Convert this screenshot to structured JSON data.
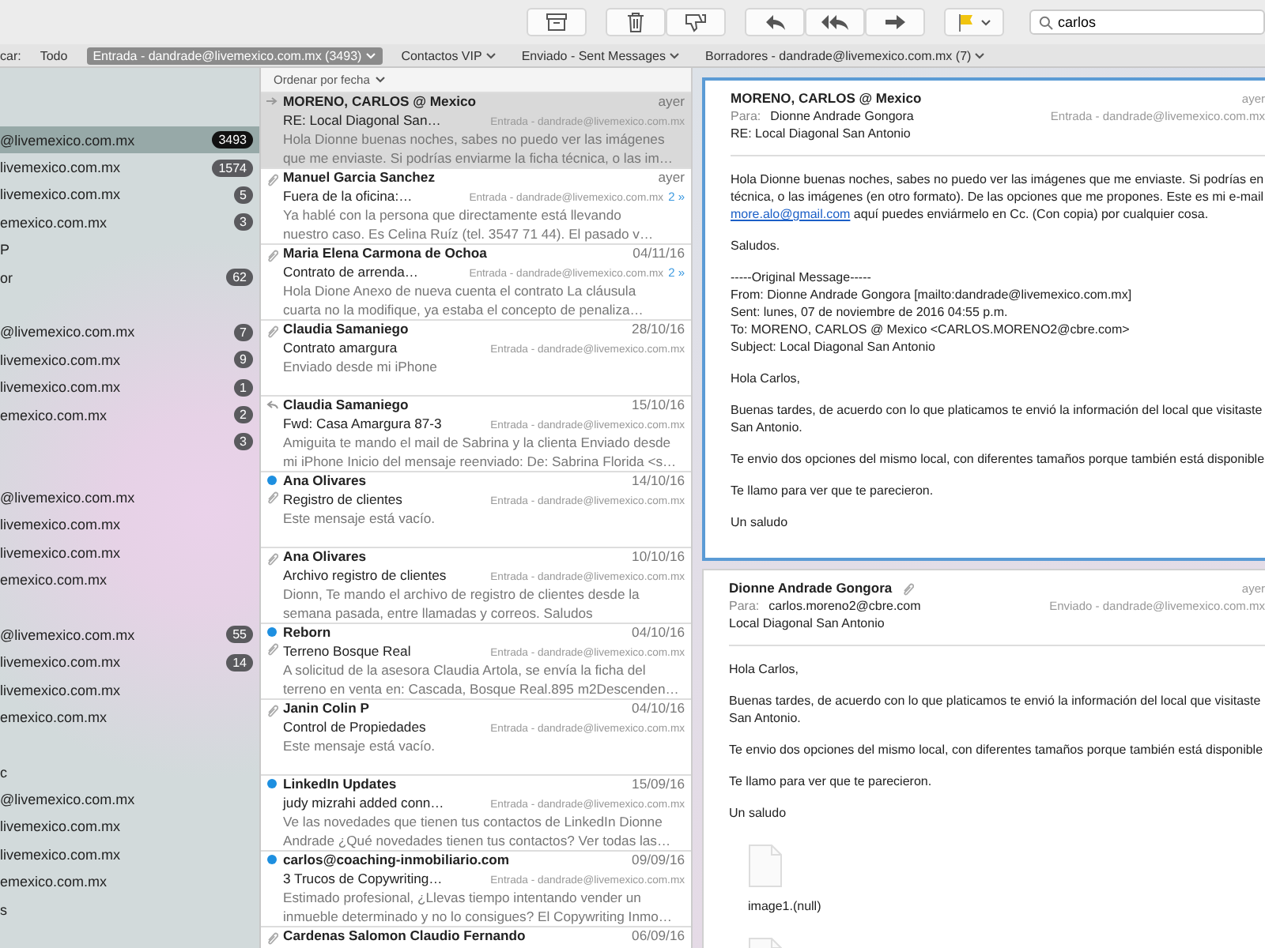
{
  "toolbar": {
    "buttons": [
      {
        "kind": "archive"
      },
      {
        "kind": "trash"
      },
      {
        "kind": "junk"
      },
      {
        "kind": "reply"
      },
      {
        "kind": "reply-all"
      },
      {
        "kind": "forward"
      },
      {
        "kind": "flag"
      }
    ],
    "search": {
      "value": "carlos"
    }
  },
  "scope_bar": {
    "label": "car:",
    "items": [
      {
        "label": "Todo",
        "selected": false
      },
      {
        "label": "Entrada - dandrade@livemexico.com.mx (3493)",
        "selected": true,
        "menu": true
      },
      {
        "label": "Contactos VIP",
        "selected": false,
        "menu": true
      },
      {
        "label": "Enviado - Sent Messages",
        "selected": false,
        "menu": true
      },
      {
        "label": "Borradores - dandrade@livemexico.com.mx (7)",
        "selected": false,
        "menu": true
      }
    ]
  },
  "sidebar": {
    "items": [
      {
        "kind": "row",
        "label": "@livemexico.com.mx",
        "count": "3493",
        "selected": true
      },
      {
        "kind": "row",
        "label": "livemexico.com.mx",
        "count": "1574",
        "selected": false
      },
      {
        "kind": "row",
        "label": "livemexico.com.mx",
        "count": "5",
        "selected": false
      },
      {
        "kind": "row",
        "label": "emexico.com.mx",
        "count": "3",
        "selected": false
      },
      {
        "kind": "row",
        "label": "P",
        "selected": false
      },
      {
        "kind": "row",
        "label": "or",
        "count": "62",
        "selected": false
      },
      {
        "kind": "gap"
      },
      {
        "kind": "row",
        "label": "@livemexico.com.mx",
        "count": "7",
        "selected": false
      },
      {
        "kind": "row",
        "label": "livemexico.com.mx",
        "count": "9",
        "selected": false
      },
      {
        "kind": "row",
        "label": "livemexico.com.mx",
        "count": "1",
        "selected": false
      },
      {
        "kind": "row",
        "label": "emexico.com.mx",
        "count": "2",
        "selected": false
      },
      {
        "kind": "row",
        "count": "3",
        "selected": false
      },
      {
        "kind": "gap"
      },
      {
        "kind": "row",
        "label": "@livemexico.com.mx",
        "selected": false
      },
      {
        "kind": "row",
        "label": "livemexico.com.mx",
        "selected": false
      },
      {
        "kind": "row",
        "label": "livemexico.com.mx",
        "selected": false
      },
      {
        "kind": "row",
        "label": "emexico.com.mx",
        "selected": false
      },
      {
        "kind": "gap"
      },
      {
        "kind": "row",
        "label": "@livemexico.com.mx",
        "count": "55",
        "selected": false
      },
      {
        "kind": "row",
        "label": "livemexico.com.mx",
        "count": "14",
        "selected": false
      },
      {
        "kind": "row",
        "label": "livemexico.com.mx",
        "selected": false
      },
      {
        "kind": "row",
        "label": "emexico.com.mx",
        "selected": false
      },
      {
        "kind": "gap"
      },
      {
        "kind": "row",
        "label": "c",
        "selected": false
      },
      {
        "kind": "row",
        "label": "@livemexico.com.mx",
        "selected": false
      },
      {
        "kind": "row",
        "label": "livemexico.com.mx",
        "selected": false
      },
      {
        "kind": "row",
        "label": "livemexico.com.mx",
        "selected": false
      },
      {
        "kind": "row",
        "label": "emexico.com.mx",
        "selected": false
      },
      {
        "kind": "row",
        "label": "s",
        "selected": false
      }
    ]
  },
  "message_list": {
    "sort": "Ordenar por fecha",
    "messages": [
      {
        "sender": "MORENO, CARLOS @ Mexico",
        "date": "ayer",
        "subject": "RE: Local Diagonal San…",
        "mailbox": "Entrada - dandrade@livemexico.com.mx",
        "preview_lines": [
          "Hola Dionne buenas noches, sabes no puedo ver las imágenes",
          "que me enviaste. Si podrías enviarme la ficha técnica, o las im…"
        ],
        "selected": true,
        "unread": false,
        "forwarded": true,
        "replied": false,
        "attachment": false
      },
      {
        "sender": "Manuel Garcia Sanchez",
        "date": "ayer",
        "subject": "Fuera de la oficina:…",
        "mailbox": "Entrada - dandrade@livemexico.com.mx",
        "thread": "2 »",
        "preview_lines": [
          "Ya hablé con la persona que directamente está llevando",
          "nuestro caso. Es Celina Ruíz (tel. 3547 71 44). El pasado v…"
        ],
        "selected": false,
        "unread": false,
        "attachment": true
      },
      {
        "sender": "Maria Elena Carmona de Ochoa",
        "date": "04/11/16",
        "subject": "Contrato de arrenda…",
        "mailbox": "Entrada - dandrade@livemexico.com.mx",
        "thread": "2 »",
        "preview_lines": [
          "Hola Dione Anexo de nueva cuenta el contrato La cláusula",
          "cuarta no la modifique, ya estaba el concepto de penaliza…"
        ],
        "selected": false,
        "unread": false,
        "attachment": true
      },
      {
        "sender": "Claudia Samaniego",
        "date": "28/10/16",
        "subject": "Contrato amargura",
        "mailbox": "Entrada - dandrade@livemexico.com.mx",
        "preview_lines": [
          "Enviado desde mi iPhone"
        ],
        "selected": false,
        "unread": false,
        "attachment": true
      },
      {
        "sender": "Claudia Samaniego",
        "date": "15/10/16",
        "subject": "Fwd: Casa Amargura 87-3",
        "mailbox": "Entrada - dandrade@livemexico.com.mx",
        "preview_lines": [
          "Amiguita te mando el mail de Sabrina y la clienta Enviado desde",
          "mi iPhone Inicio del mensaje reenviado: De: Sabrina Florida <s…"
        ],
        "selected": false,
        "unread": false,
        "forwarded": false,
        "replied": true,
        "attachment": false
      },
      {
        "sender": "Ana Olivares",
        "date": "14/10/16",
        "subject": "Registro de clientes",
        "mailbox": "Entrada - dandrade@livemexico.com.mx",
        "preview_lines": [
          "Este mensaje está vacío."
        ],
        "selected": false,
        "unread": true,
        "attachment": true
      },
      {
        "sender": "Ana Olivares",
        "date": "10/10/16",
        "subject": "Archivo registro de clientes",
        "mailbox": "Entrada - dandrade@livemexico.com.mx",
        "preview_lines": [
          "Dionn, Te mando el archivo de registro de clientes desde la",
          "semana pasada, entre llamadas y correos. Saludos"
        ],
        "selected": false,
        "unread": false,
        "attachment": true
      },
      {
        "sender": "Reborn",
        "date": "04/10/16",
        "subject": "Terreno Bosque Real",
        "mailbox": "Entrada - dandrade@livemexico.com.mx",
        "preview_lines": [
          "A solicitud de la asesora Claudia Artola, se envía la ficha del",
          "terreno en venta en: Cascada, Bosque Real.895 m2Descenden…"
        ],
        "selected": false,
        "unread": true,
        "attachment": true
      },
      {
        "sender": "Janin Colin P",
        "date": "04/10/16",
        "subject": "Control de Propiedades",
        "mailbox": "Entrada - dandrade@livemexico.com.mx",
        "preview_lines": [
          "Este mensaje está vacío."
        ],
        "selected": false,
        "unread": false,
        "attachment": true
      },
      {
        "sender": "LinkedIn Updates",
        "date": "15/09/16",
        "subject": "judy mizrahi added conn…",
        "mailbox": "Entrada - dandrade@livemexico.com.mx",
        "preview_lines": [
          "Ve las novedades que tienen tus contactos de LinkedIn Dionne",
          "Andrade ¿Qué novedades tienen tus contactos? Ver todas las…"
        ],
        "selected": false,
        "unread": true,
        "attachment": false
      },
      {
        "sender": "carlos@coaching-inmobiliario.com",
        "date": "09/09/16",
        "subject": "3 Trucos de Copywriting…",
        "mailbox": "Entrada - dandrade@livemexico.com.mx",
        "preview_lines": [
          "Estimado profesional,   ¿Llevas tiempo intentando vender un",
          "inmueble determinado y no lo consigues?  El Copywriting Inmo…"
        ],
        "selected": false,
        "unread": true,
        "attachment": false
      },
      {
        "sender": "Cardenas Salomon Claudio Fernando",
        "date": "06/09/16",
        "selected": false,
        "unread": false,
        "attachment": true
      }
    ]
  },
  "reading_pane": {
    "messages": [
      {
        "from": "MORENO, CARLOS @ Mexico",
        "date": "ayer",
        "to_label": "Para:",
        "to": "Dionne Andrade Gongora",
        "mailbox": "Entrada - dandrade@livemexico.com.mx",
        "subject": "RE: Local Diagonal San Antonio",
        "selected": true,
        "attachment": false,
        "body": [
          [
            {
              "text": "Hola Dionne buenas noches, sabes no puedo ver las imágenes que me enviaste. Si podrías en"
            },
            {
              "text": "técnica, o las imágenes (en otro formato). De las opciones que me propones. Este es mi e-mail"
            },
            {
              "link": "more.alo@gmail.com",
              "text": " aquí puedes enviármelo en Cc. (Con copia) por cualquier cosa."
            }
          ],
          [
            {
              "text": "Saludos."
            }
          ],
          [
            {
              "text": "-----Original Message-----"
            },
            {
              "text": "From: Dionne Andrade Gongora [mailto:dandrade@livemexico.com.mx]"
            },
            {
              "text": "Sent: lunes, 07 de noviembre de 2016 04:55 p.m."
            },
            {
              "text": "To: MORENO, CARLOS @ Mexico <CARLOS.MORENO2@cbre.com>"
            },
            {
              "text": "Subject: Local Diagonal San Antonio"
            }
          ],
          [
            {
              "text": "Hola Carlos,"
            }
          ],
          [
            {
              "text": "Buenas tardes, de acuerdo con lo que platicamos te envió la información del local que visitaste"
            },
            {
              "text": "San Antonio."
            }
          ],
          [
            {
              "text": "Te envio dos opciones del mismo local, con diferentes tamaños porque también está disponible"
            }
          ],
          [
            {
              "text": "Te llamo para ver que te parecieron."
            }
          ],
          [
            {
              "text": "Un saludo"
            }
          ]
        ]
      },
      {
        "from": "Dionne Andrade Gongora",
        "date": "ayer",
        "to_label": "Para:",
        "to": "carlos.moreno2@cbre.com",
        "mailbox": "Enviado - dandrade@livemexico.com.mx",
        "subject": "Local Diagonal San Antonio",
        "selected": false,
        "attachment": true,
        "body": [
          [
            {
              "text": "Hola Carlos,"
            }
          ],
          [
            {
              "text": "Buenas tardes, de acuerdo con lo que platicamos te envió la información del local que visitaste"
            },
            {
              "text": "San Antonio."
            }
          ],
          [
            {
              "text": "Te envio dos opciones del mismo local, con diferentes tamaños porque también está disponible"
            }
          ],
          [
            {
              "text": "Te llamo para ver que te parecieron."
            }
          ],
          [
            {
              "text": "Un saludo"
            }
          ]
        ],
        "files": [
          {
            "kind": "file",
            "name": "image1.(null)"
          },
          {
            "kind": "file"
          }
        ]
      }
    ]
  }
}
